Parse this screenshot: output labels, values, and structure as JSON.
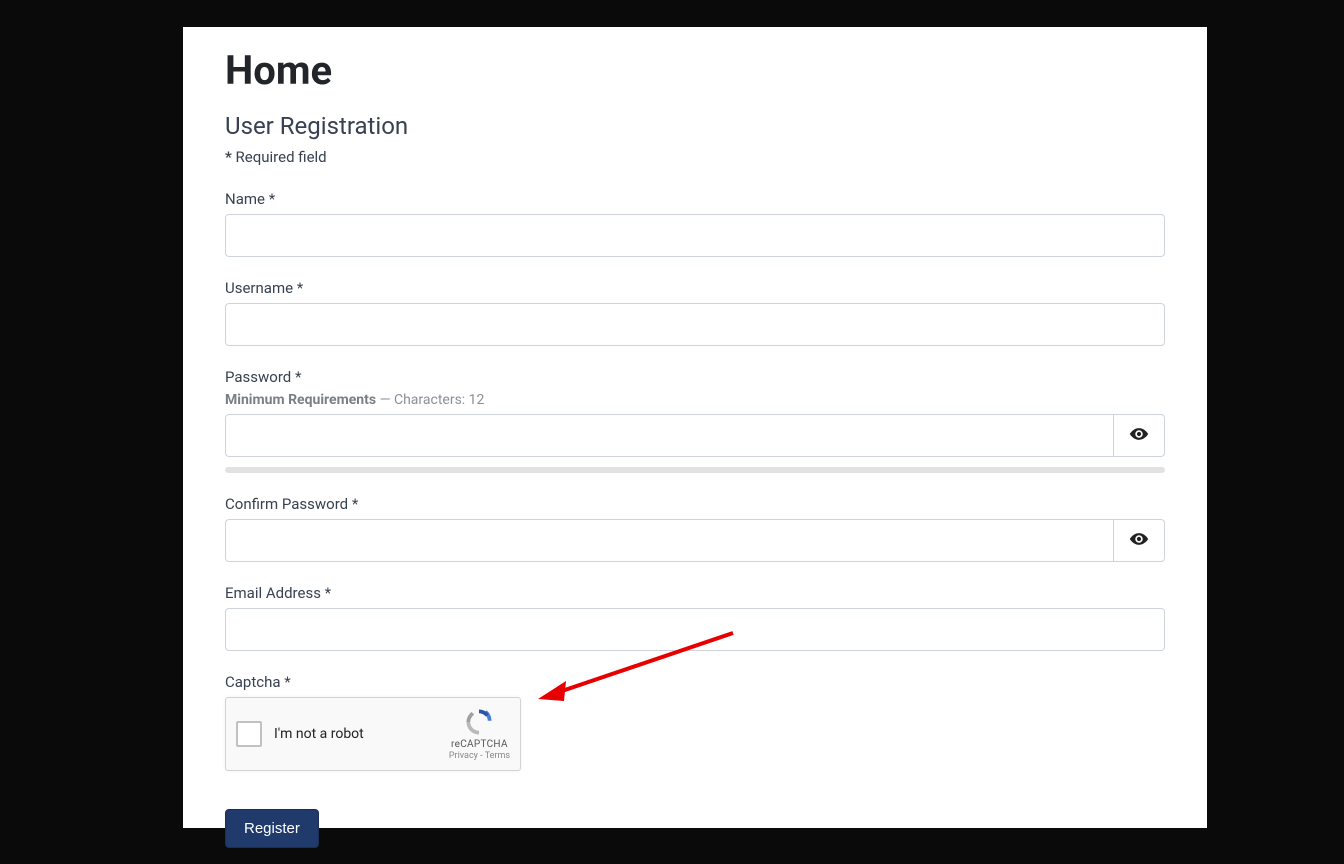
{
  "page": {
    "title": "Home",
    "subtitle": "User Registration",
    "required_star": "*",
    "required_text": " Required field"
  },
  "fields": {
    "name": {
      "label": "Name *"
    },
    "username": {
      "label": "Username *"
    },
    "password": {
      "label": "Password *",
      "hint_strong": "Minimum Requirements",
      "hint_rest": " — Characters: 12"
    },
    "confirm": {
      "label": "Confirm Password *"
    },
    "email": {
      "label": "Email Address *"
    },
    "captcha": {
      "label": "Captcha *"
    }
  },
  "recaptcha": {
    "text": "I'm not a robot",
    "brand": "reCAPTCHA",
    "privacy": "Privacy",
    "terms": "Terms",
    "sep": " - "
  },
  "buttons": {
    "register": "Register"
  }
}
